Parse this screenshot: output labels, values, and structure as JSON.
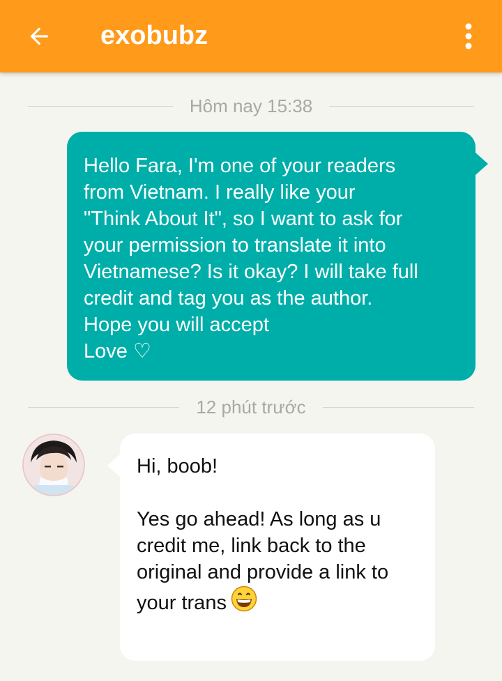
{
  "header": {
    "title": "exobubz",
    "back_icon": "arrow-back-icon",
    "more_icon": "more-vertical-icon",
    "bar_color": "#ff9a1a"
  },
  "conversation": {
    "timestamp_1": "Hôm nay 15:38",
    "outgoing_message": {
      "lines": [
        "Hello Fara, I'm one of your readers",
        "from Vietnam. I really like your",
        "\"Think About It\", so I want to ask for",
        "your permission to translate it into",
        "Vietnamese? Is it okay? I will take full",
        "credit and tag you as the author.",
        "Hope you will accept",
        "Love ♡"
      ],
      "bubble_color": "#00aea9"
    },
    "timestamp_2": "12 phút trước",
    "incoming_message": {
      "avatar": "user-avatar",
      "lines": [
        "Hi, boob!",
        "",
        "Yes go ahead! As long as u",
        "credit me, link back to the",
        "original and provide a link to",
        "your trans"
      ],
      "emoji": "grinning-face-emoji",
      "bubble_color": "#ffffff"
    }
  }
}
